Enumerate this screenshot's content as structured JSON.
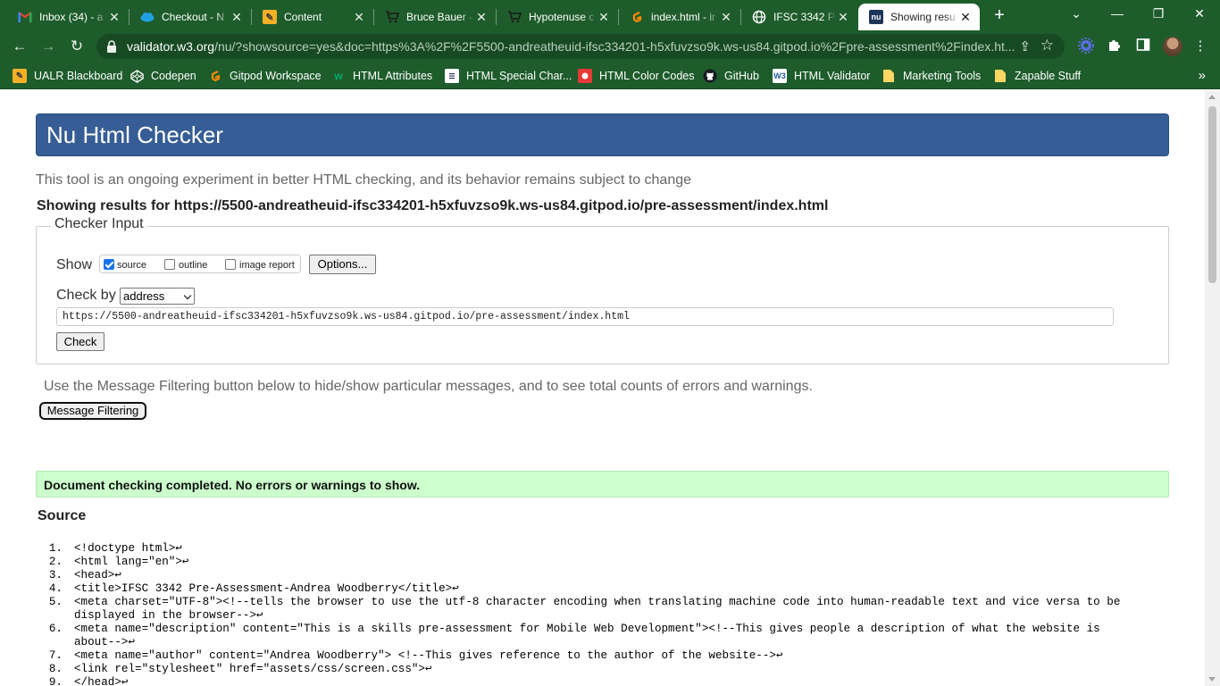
{
  "tabs": [
    {
      "title": "Inbox (34) - a",
      "icon": "gmail-icon",
      "active": false
    },
    {
      "title": "Checkout - N",
      "icon": "cloud-icon",
      "active": false
    },
    {
      "title": "Content",
      "icon": "pencil-icon",
      "active": false
    },
    {
      "title": "Bruce Bauer -",
      "icon": "cart-icon",
      "active": false
    },
    {
      "title": "Hypotenuse c",
      "icon": "cart-icon",
      "active": false
    },
    {
      "title": "index.html - ir",
      "icon": "gitpod-icon",
      "active": false
    },
    {
      "title": "IFSC 3342 Pre",
      "icon": "globe-icon",
      "active": false
    },
    {
      "title": "Showing resu",
      "icon": "nu-icon",
      "active": true
    }
  ],
  "address_bar": {
    "host": "validator.w3.org",
    "path": "/nu/?showsource=yes&doc=https%3A%2F%2F5500-andreatheuid-ifsc334201-h5xfuvzso9k.ws-us84.gitpod.io%2Fpre-assessment%2Findex.ht..."
  },
  "bookmarks": [
    {
      "label": "UALR Blackboard",
      "icon": "pencil-icon"
    },
    {
      "label": "Codepen",
      "icon": "codepen-icon"
    },
    {
      "label": "Gitpod Workspace",
      "icon": "gitpod-icon"
    },
    {
      "label": "HTML Attributes",
      "icon": "w3schools-icon"
    },
    {
      "label": "HTML Special Char...",
      "icon": "document-icon"
    },
    {
      "label": "HTML Color Codes",
      "icon": "color-icon"
    },
    {
      "label": "GitHub",
      "icon": "github-icon"
    },
    {
      "label": "HTML Validator",
      "icon": "w3c-icon"
    },
    {
      "label": "Marketing Tools",
      "icon": "folder-icon"
    },
    {
      "label": "Zapable Stuff",
      "icon": "folder-icon"
    }
  ],
  "page": {
    "title": "Nu Html Checker",
    "intro": "This tool is an ongoing experiment in better HTML checking, and its behavior remains subject to change",
    "results_heading": "Showing results for https://5500-andreatheuid-ifsc334201-h5xfuvzso9k.ws-us84.gitpod.io/pre-assessment/index.html",
    "checker_input": {
      "legend": "Checker Input",
      "show_label": "Show",
      "options": [
        {
          "label": "source",
          "checked": true
        },
        {
          "label": "outline",
          "checked": false
        },
        {
          "label": "image report",
          "checked": false
        }
      ],
      "options_button": "Options...",
      "check_by_label": "Check by",
      "check_by_value": "address",
      "url_value": "https://5500-andreatheuid-ifsc334201-h5xfuvzso9k.ws-us84.gitpod.io/pre-assessment/index.html",
      "check_button": "Check"
    },
    "filter_note": "Use the Message Filtering button below to hide/show particular messages, and to see total counts of errors and warnings.",
    "filter_button": "Message Filtering",
    "success_message": "Document checking completed. No errors or warnings to show.",
    "source_heading": "Source",
    "source_lines": [
      {
        "n": "1.",
        "text": "<!doctype html>↩"
      },
      {
        "n": "2.",
        "text": "<html lang=\"en\">↩"
      },
      {
        "n": "3.",
        "text": "<head>↩"
      },
      {
        "n": "4.",
        "text": "<title>IFSC 3342 Pre-Assessment-Andrea Woodberry</title>↩"
      },
      {
        "n": "5.",
        "text": "<meta charset=\"UTF-8\"><!--tells the browser to use the utf-8 character encoding when translating machine code into human-readable text and vice versa to be displayed in the browser-->↩"
      },
      {
        "n": "6.",
        "text": "<meta name=\"description\" content=\"This is a skills pre-assessment for Mobile Web Development\"><!--This gives people a description of what the website is about-->↩"
      },
      {
        "n": "7.",
        "text": "<meta name=\"author\" content=\"Andrea Woodberry\"> <!--This gives reference to the author of the website-->↩"
      },
      {
        "n": "8.",
        "text": "<link rel=\"stylesheet\" href=\"assets/css/screen.css\">↩"
      },
      {
        "n": "9.",
        "text": "</head>↩"
      }
    ]
  }
}
